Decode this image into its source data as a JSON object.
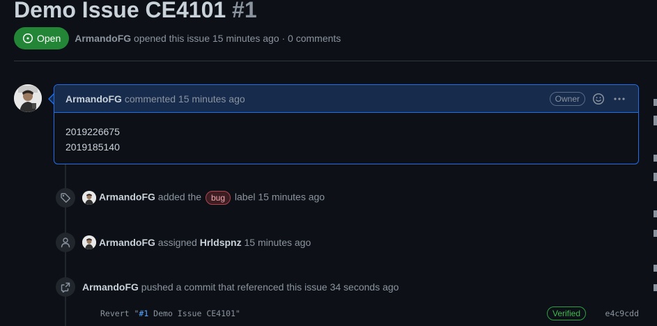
{
  "issue": {
    "title": "Demo Issue CE4101",
    "number": "#1",
    "state": "Open",
    "author": "ArmandoFG",
    "meta_text": "opened this issue 15 minutes ago · 0 comments"
  },
  "comment": {
    "author": "ArmandoFG",
    "action": "commented 15 minutes ago",
    "badge": "Owner",
    "body_lines": [
      "2019226675",
      "2019185140"
    ]
  },
  "events": {
    "label": {
      "icon": "tag-icon",
      "author": "ArmandoFG",
      "text_before": "added the",
      "label": "bug",
      "text_after": "label 15 minutes ago"
    },
    "assign": {
      "icon": "person-icon",
      "author": "ArmandoFG",
      "text_before": "assigned",
      "assignee": "Hrldspnz",
      "text_after": "15 minutes ago"
    },
    "commit": {
      "icon": "cross-reference-icon",
      "author": "ArmandoFG",
      "text": "pushed a commit that referenced this issue 34 seconds ago",
      "message_prefix": "Revert \"",
      "message_link": "#1",
      "message_suffix": " Demo Issue CE4101\"",
      "verified": "Verified",
      "sha": "e4c9cdd"
    }
  },
  "colors": {
    "background": "#0d1117",
    "open_green": "#238636",
    "accent_blue": "#1f6feb",
    "label_bug": "#b0454d",
    "verified_green": "#3fb950"
  }
}
